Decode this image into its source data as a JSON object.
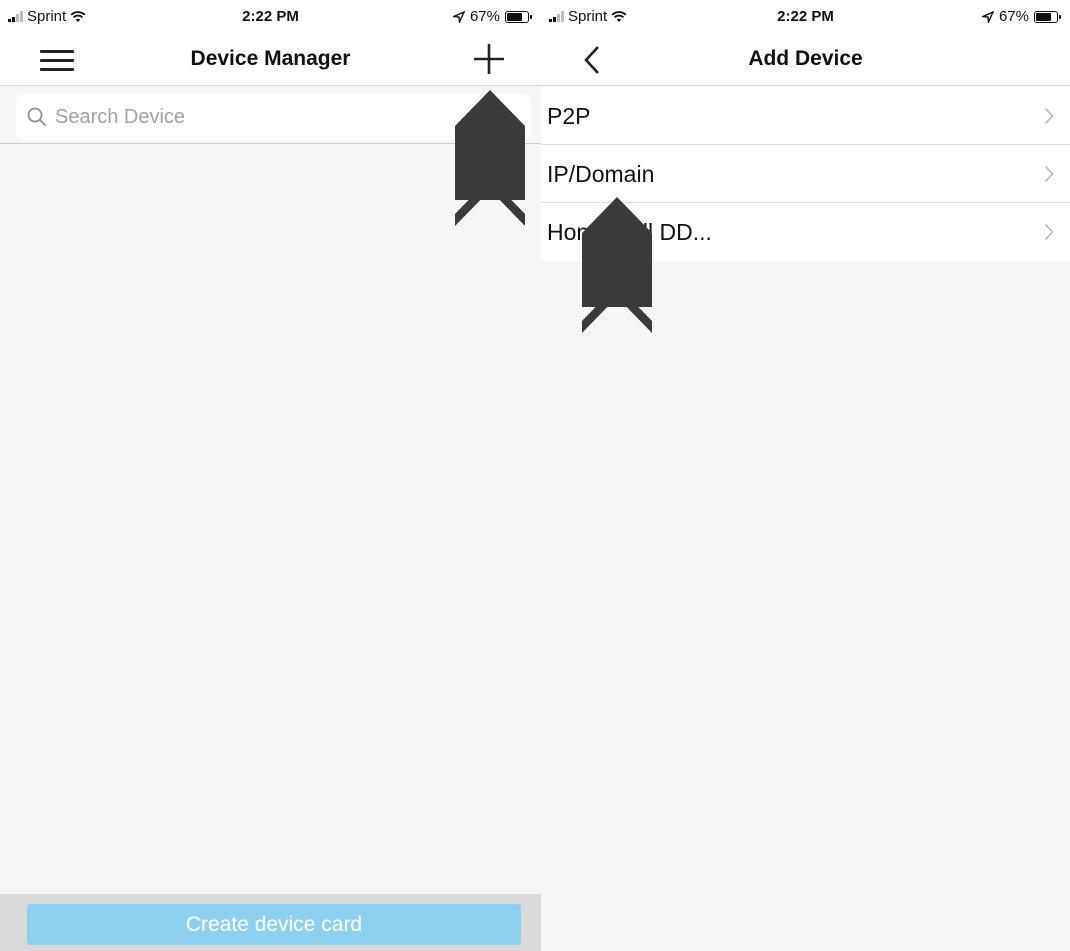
{
  "left_screen": {
    "status": {
      "carrier": "Sprint",
      "time": "2:22 PM",
      "battery": "67%"
    },
    "nav": {
      "title": "Device Manager"
    },
    "search": {
      "placeholder": "Search Device"
    },
    "footer": {
      "create_label": "Create device card"
    },
    "icons": [
      "menu-icon",
      "add-icon",
      "search-icon"
    ]
  },
  "right_screen": {
    "status": {
      "carrier": "Sprint",
      "time": "2:22 PM",
      "battery": "67%"
    },
    "nav": {
      "title": "Add Device"
    },
    "options": [
      {
        "label": "P2P"
      },
      {
        "label": "IP/Domain"
      },
      {
        "label": "Honeywell DD..."
      }
    ],
    "icons": [
      "back-icon",
      "chevron-right-icon"
    ]
  },
  "colors": {
    "button_bg": "#8dd0ef",
    "page_bg": "#f6f6f6",
    "arrow": "#3a3a3a"
  }
}
